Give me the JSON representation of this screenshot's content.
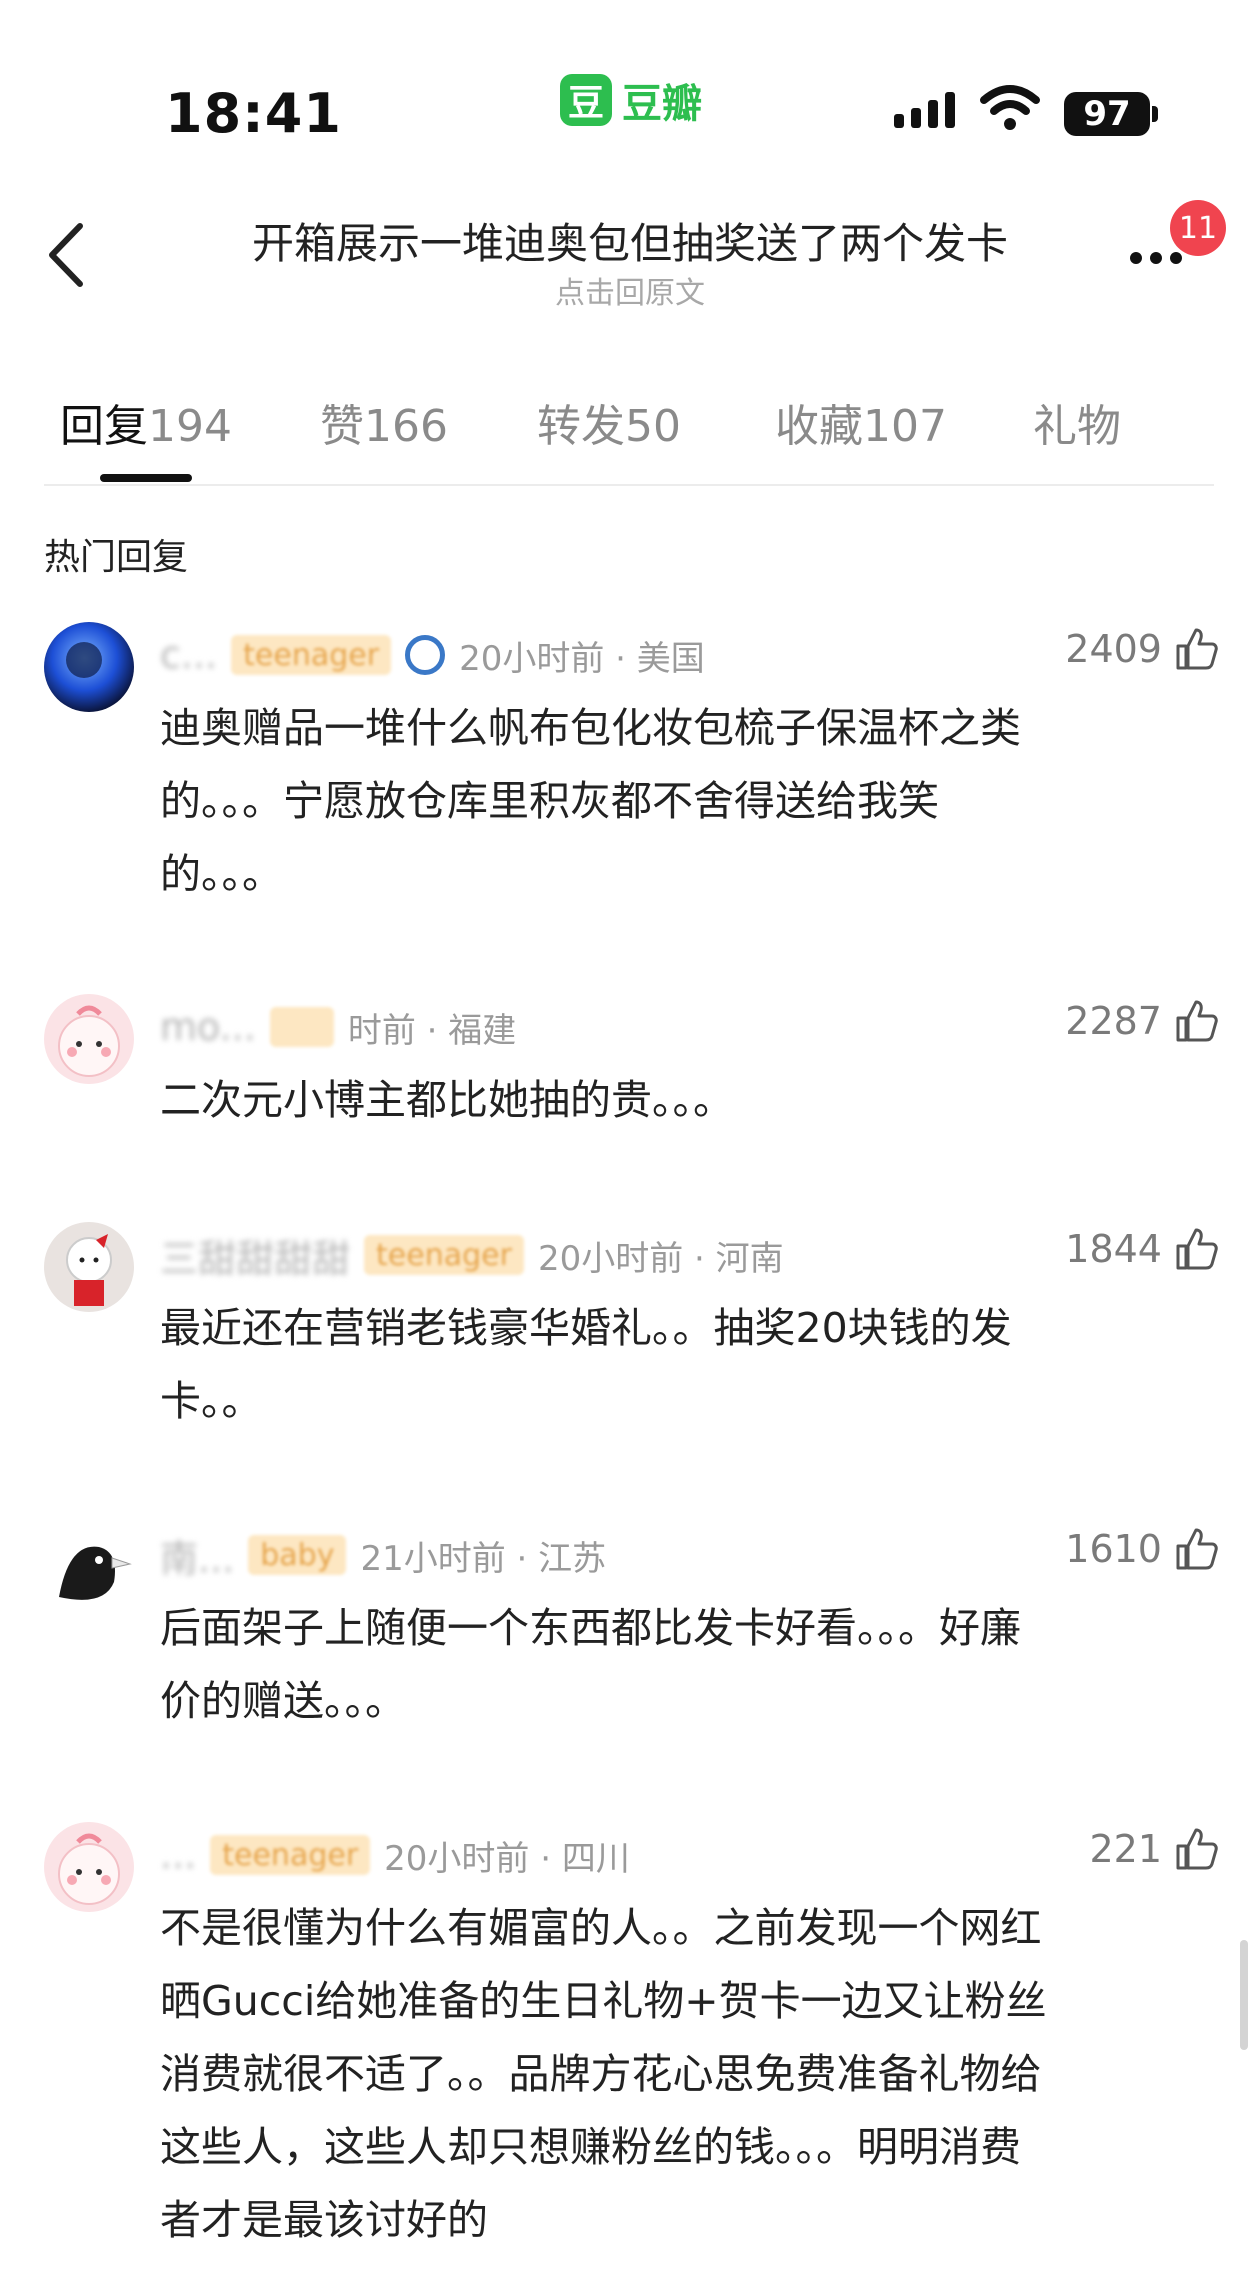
{
  "status_bar": {
    "time": "18:41",
    "app_logo_text": "豆",
    "app_name": "豆瓣",
    "battery": "97"
  },
  "nav": {
    "title": "开箱展示一堆迪奥包但抽奖送了两个发卡",
    "subtitle": "点击回原文",
    "more_badge": "11"
  },
  "tabs": [
    {
      "label": "回复",
      "count": "194",
      "active": true
    },
    {
      "label": "赞",
      "count": "166"
    },
    {
      "label": "转发",
      "count": "50"
    },
    {
      "label": "收藏",
      "count": "107"
    },
    {
      "label": "礼物",
      "count": ""
    }
  ],
  "section_heading": "热门回复",
  "comments": [
    {
      "username": "c...",
      "tag": "teenager",
      "meta": "20小时前 · 美国",
      "likes": "2409",
      "lines": [
        "迪奥赠品一堆什么帆布包化妆包梳子保温杯之类",
        "的。。。宁愿放仓库里积灰都不舍得送给我笑",
        "的。。。"
      ]
    },
    {
      "username": "mo...",
      "tag": "",
      "meta": "时前 · 福建",
      "likes": "2287",
      "lines": [
        "二次元小博主都比她抽的贵。。。"
      ]
    },
    {
      "username": "三甜甜甜甜",
      "tag": "teenager",
      "meta": "20小时前 · 河南",
      "likes": "1844",
      "lines": [
        "最近还在营销老钱豪华婚礼。。抽奖20块钱的发",
        "卡。。"
      ]
    },
    {
      "username": "南...",
      "tag": "baby",
      "meta": "21小时前 · 江苏",
      "likes": "1610",
      "lines": [
        "后面架子上随便一个东西都比发卡好看。。。好廉",
        "价的赠送。。。"
      ]
    },
    {
      "username": "...",
      "tag": "teenager",
      "meta": "20小时前 · 四川",
      "likes": "221",
      "lines": [
        "不是很懂为什么有媚富的人。。之前发现一个网红",
        "晒Gucci给她准备的生日礼物+贺卡一边又让粉丝",
        "消费就很不适了。。品牌方花心思免费准备礼物给",
        "这些人，这些人却只想赚粉丝的钱。。。明明消费",
        "者才是最该讨好的"
      ]
    }
  ]
}
